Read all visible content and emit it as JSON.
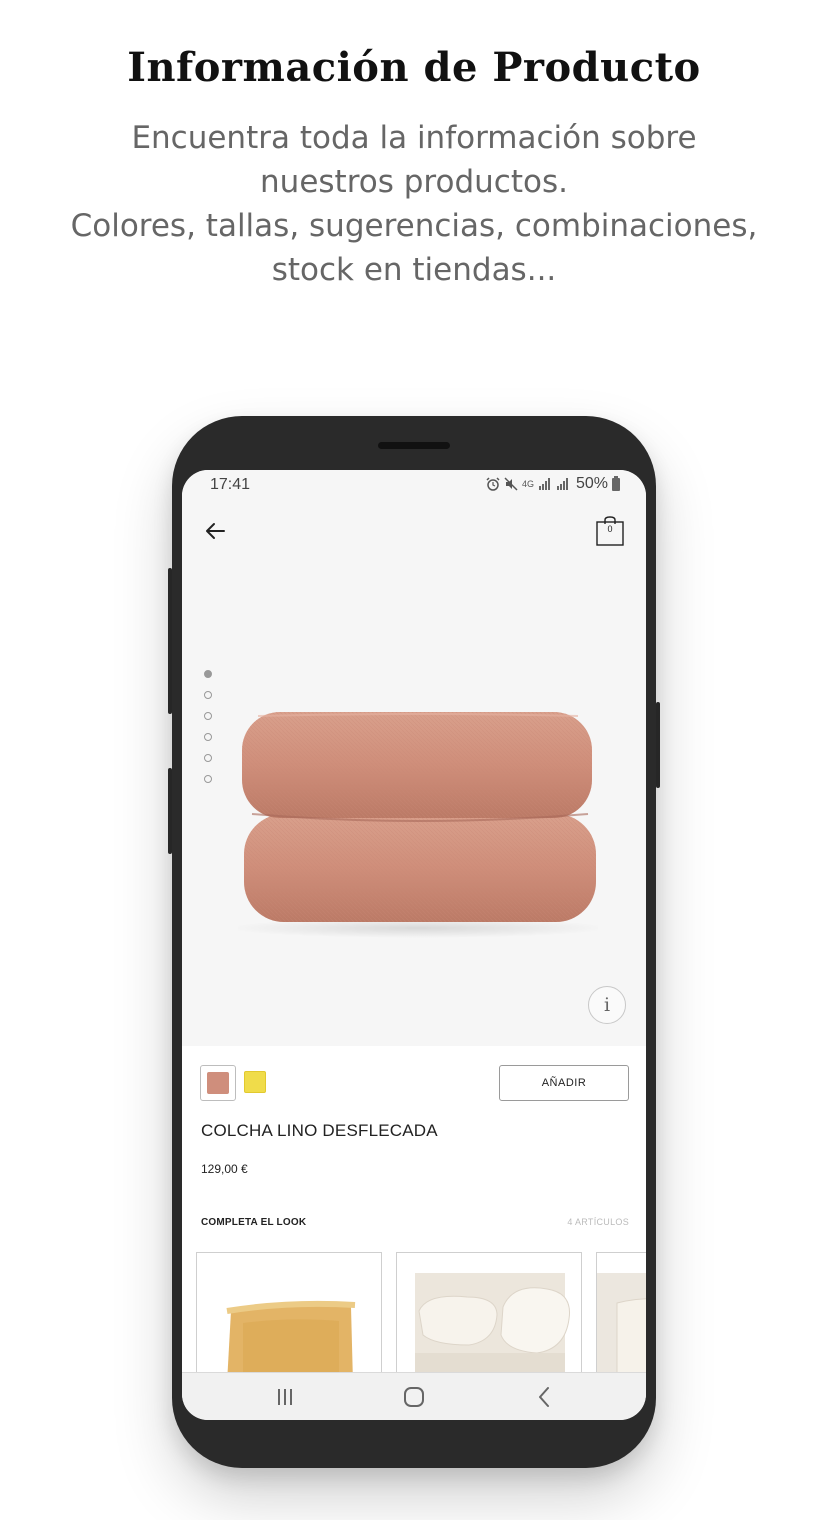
{
  "promo": {
    "title": "Información de Producto",
    "subtitle_lines": [
      "Encuentra toda la información sobre",
      "nuestros productos.",
      "Colores, tallas, sugerencias, combinaciones,",
      "stock en tiendas..."
    ]
  },
  "status_bar": {
    "time": "17:41",
    "network": "4G",
    "battery": "50%",
    "icons": [
      "alarm-icon",
      "mute-icon",
      "network-4g-icon",
      "signal-icon",
      "signal-icon",
      "battery-icon"
    ]
  },
  "header": {
    "back_icon": "arrow-left-icon",
    "cart_icon": "shopping-bag-icon",
    "cart_count": "0"
  },
  "gallery": {
    "image_count": 6,
    "active_index": 0,
    "info_label": "i"
  },
  "product": {
    "colors": [
      {
        "name": "terracotta",
        "hex": "#cf8e7c",
        "selected": true
      },
      {
        "name": "yellow",
        "hex": "#f0dc4a",
        "selected": false
      }
    ],
    "add_label": "AÑADIR",
    "name": "COLCHA LINO DESFLECADA",
    "price": "129,00 €"
  },
  "complete_look": {
    "title": "COMPLETA EL LOOK",
    "count": "4 ARTÍCULOS",
    "items": [
      "cushion-mustard-image",
      "pillows-white-image",
      "pillow-white-image"
    ]
  },
  "nav_bar": {
    "buttons": [
      "recent-apps-icon",
      "home-icon",
      "back-icon"
    ]
  },
  "colors": {
    "page_bg": "#ffffff",
    "phone_body": "#2a2a2a",
    "screen_bg": "#f6f6f6",
    "accent_text": "#222222",
    "muted_text": "#666666"
  }
}
